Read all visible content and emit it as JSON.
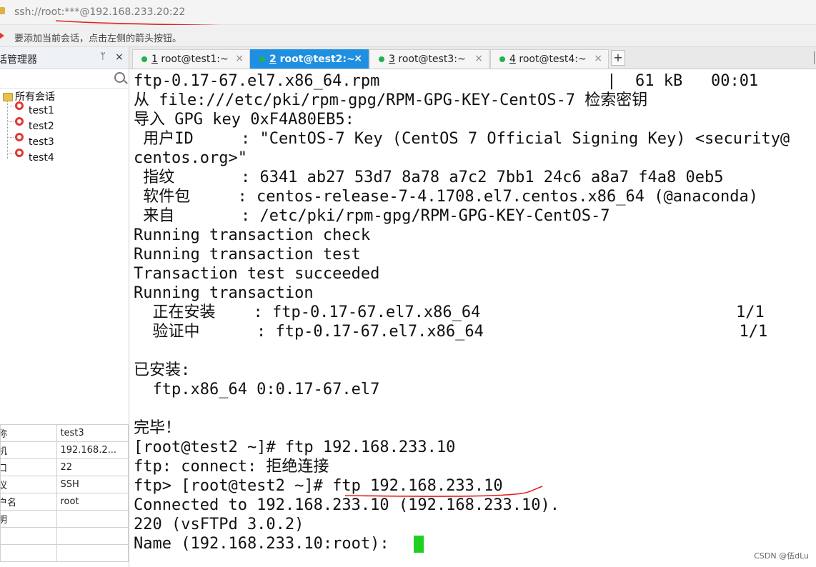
{
  "address": {
    "url": "ssh://root:***@192.168.233.20:22"
  },
  "hint": {
    "text": "要添加当前会话，点击左侧的箭头按钮。"
  },
  "sidebar": {
    "title": "话管理器",
    "pin_label": "ᛘ",
    "close_label": "×",
    "root": "所有会话",
    "sessions": [
      "test1",
      "test2",
      "test3",
      "test4"
    ]
  },
  "properties": [
    {
      "key": "称",
      "value": "test3"
    },
    {
      "key": "机",
      "value": "192.168.2..."
    },
    {
      "key": "口",
      "value": "22"
    },
    {
      "key": "议",
      "value": "SSH"
    },
    {
      "key": "户名",
      "value": "root"
    },
    {
      "key": "明",
      "value": ""
    },
    {
      "key": "",
      "value": ""
    },
    {
      "key": "",
      "value": ""
    }
  ],
  "tabs": [
    {
      "num": "1",
      "label": " root@test1:~",
      "close": "×",
      "active": false
    },
    {
      "num": "2",
      "label": " root@test2:~",
      "close": "×",
      "active": true
    },
    {
      "num": "3",
      "label": " root@test3:~",
      "close": "×",
      "active": false
    },
    {
      "num": "4",
      "label": " root@test4:~",
      "close": "×",
      "active": false
    }
  ],
  "new_tab_label": "+",
  "terminal": {
    "lines": [
      "ftp-0.17-67.el7.x86_64.rpm                        |  61 kB   00:01",
      "从 file:///etc/pki/rpm-gpg/RPM-GPG-KEY-CentOS-7 检索密钥",
      "导入 GPG key 0xF4A80EB5:",
      " 用户ID     : \"CentOS-7 Key (CentOS 7 Official Signing Key) <security@",
      "centos.org>\"",
      " 指纹       : 6341 ab27 53d7 8a78 a7c2 7bb1 24c6 a8a7 f4a8 0eb5",
      " 软件包     : centos-release-7-4.1708.el7.centos.x86_64 (@anaconda)",
      " 来自       : /etc/pki/rpm-gpg/RPM-GPG-KEY-CentOS-7",
      "Running transaction check",
      "Running transaction test",
      "Transaction test succeeded",
      "Running transaction",
      "  正在安装    : ftp-0.17-67.el7.x86_64                           1/1",
      "  验证中      : ftp-0.17-67.el7.x86_64                           1/1",
      "",
      "已安装:",
      "  ftp.x86_64 0:0.17-67.el7",
      "",
      "完毕！",
      "[root@test2 ~]# ftp 192.168.233.10",
      "ftp: connect: 拒绝连接",
      "ftp> [root@test2 ~]# ftp 192.168.233.10",
      "Connected to 192.168.233.10 (192.168.233.10).",
      "220 (vsFTPd 3.0.2)",
      "Name (192.168.233.10:root): "
    ]
  },
  "watermark": "CSDN @伍dLu",
  "colors": {
    "active_tab": "#1e8fe1",
    "cursor": "#1fd11f",
    "annotation": "#e02020"
  }
}
